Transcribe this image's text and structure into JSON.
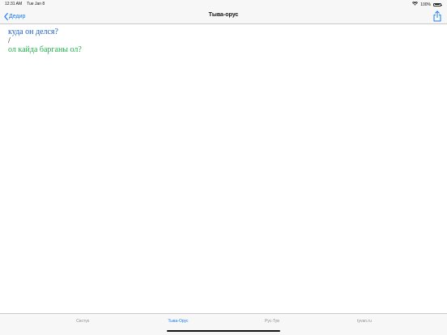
{
  "status_bar": {
    "time": "12:31 AM",
    "date": "Tue Jan 8",
    "battery_percent": "100%",
    "icons": [
      "wifi-icon",
      "battery-icon"
    ]
  },
  "nav": {
    "back_label": "Дедир",
    "title": "Тыва-орус",
    "share_icon": "share-icon",
    "accent_color": "#1a7cf3"
  },
  "content": {
    "russian_phrase": "куда он делся?",
    "separator": "/",
    "tuvan_phrase": "ол кайда барганы ол?",
    "russian_color": "#1f5fc8",
    "tuvan_color": "#22b14c"
  },
  "tabs": [
    {
      "label": "Сөстүк",
      "active": false
    },
    {
      "label": "Тыва-Орус",
      "active": true
    },
    {
      "label": "Рус-Тув",
      "active": false
    },
    {
      "label": "tyvan.ru",
      "active": false
    }
  ]
}
